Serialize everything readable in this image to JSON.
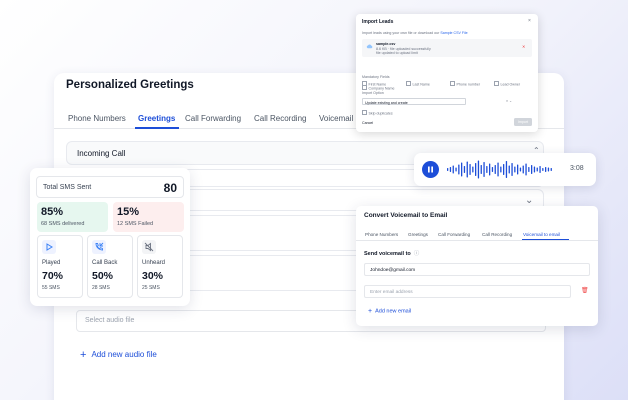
{
  "greetings": {
    "title": "Personalized Greetings",
    "tabs": [
      "Phone Numbers",
      "Greetings",
      "Call Forwarding",
      "Call Recording",
      "Voicemail"
    ],
    "active_tab": 1,
    "incoming_call_title": "Incoming Call",
    "audio_select_placeholder": "Select audio file",
    "add_audio_label": "Add new audio file"
  },
  "import_leads": {
    "title": "Import Leads",
    "close": "×",
    "description": "Import leads using your own file or download our",
    "description_link": "Sample CSV File",
    "file_name": "sample.csv",
    "file_size": "8.6 KB · file uploaded successfully",
    "file_note": "file updated to upload limit",
    "delete": "✕",
    "mandatory_fields_label": "Mandatory Fields",
    "checkboxes": [
      "First Name",
      "Last Name",
      "Phone number",
      "Lead Owner"
    ],
    "company_checkbox": "Company Name",
    "import_option_label": "Import Option",
    "import_option_value": "Update existing and create",
    "skip_duplicates": "Skip duplicates",
    "cancel": "Cancel",
    "import_button": "Import"
  },
  "sms_stats": {
    "total_label": "Total SMS Sent",
    "total_value": "80",
    "delivered_pct": "85%",
    "delivered_sub": "68 SMS delivered",
    "failed_pct": "15%",
    "failed_sub": "12 SMS Failed",
    "played_label": "Played",
    "played_pct": "70%",
    "played_sub": "55 SMS",
    "callback_label": "Call Back",
    "callback_pct": "50%",
    "callback_sub": "28 SMS",
    "unheard_label": "Unheard",
    "unheard_pct": "30%",
    "unheard_sub": "25 SMS"
  },
  "player": {
    "time": "3:08",
    "accent_color": "#1d4ed8"
  },
  "voicemail_email": {
    "title": "Convert Voicemail to Email",
    "tabs": [
      "Phone Numbers",
      "Greetings",
      "Call Forwarding",
      "Call Recording",
      "Voicemail to email"
    ],
    "active_tab": 4,
    "send_label": "Send voicemail to",
    "info_icon": "ⓘ",
    "email_value": "Johndoe@gmail.com",
    "email_placeholder": "Enter email address",
    "add_email_label": "Add new email"
  }
}
